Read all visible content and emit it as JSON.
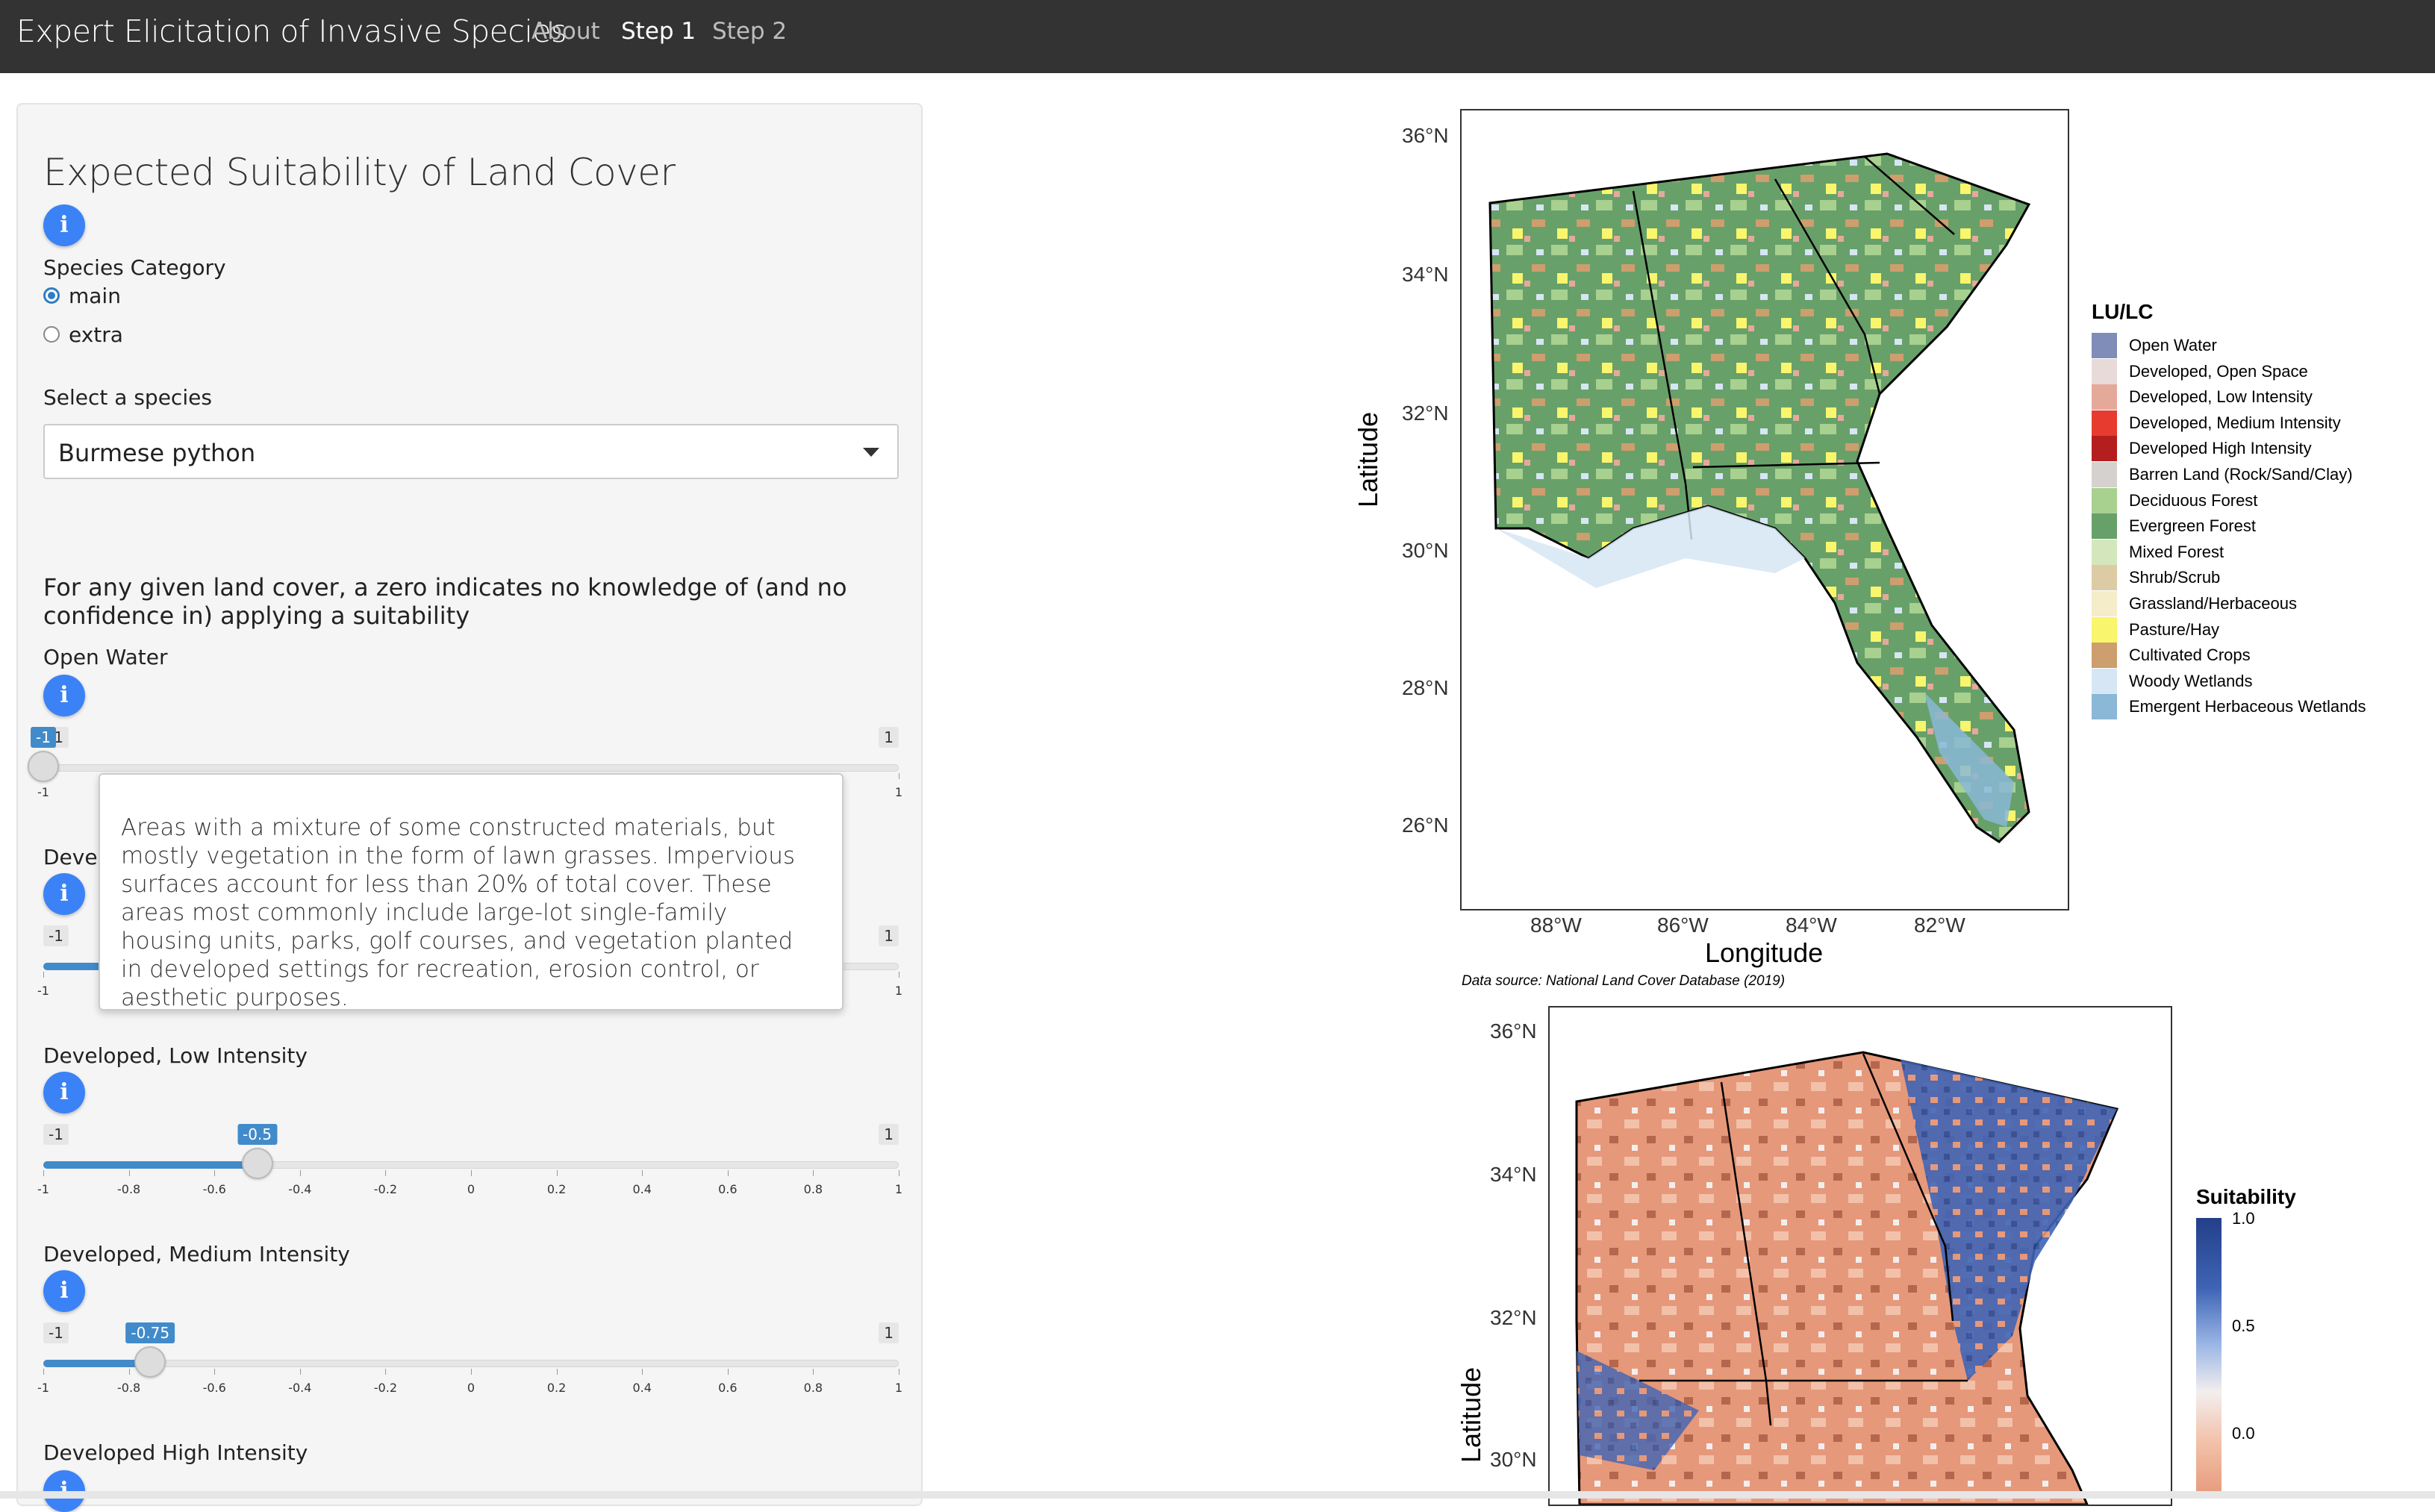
{
  "navbar": {
    "brand": "Expert Elicitation of Invasive Species",
    "links": [
      "About",
      "Step 1",
      "Step 2"
    ],
    "active": "Step 1"
  },
  "sidebar": {
    "title": "Expected Suitability of Land Cover",
    "species_category_label": "Species Category",
    "radio_options": [
      "main",
      "extra"
    ],
    "radio_selected": "main",
    "select_label": "Select a species",
    "select_value": "Burmese python",
    "description": "For any given land cover, a zero indicates no knowledge of (and no confidence in) applying a suitability",
    "slider_ticks": [
      "-1",
      "-0.8",
      "-0.6",
      "-0.4",
      "-0.2",
      "0",
      "0.2",
      "0.4",
      "0.6",
      "0.8",
      "1"
    ],
    "slider_min": "-1",
    "slider_max": "1",
    "sliders": [
      {
        "label": "Open Water",
        "value": "-1",
        "num": -1
      },
      {
        "label": "Developed, Open Space",
        "label_visible": "Develo",
        "value": "-1",
        "num": -0.4
      },
      {
        "label": "Developed, Low Intensity",
        "value": "-0.5",
        "num": -0.5
      },
      {
        "label": "Developed, Medium Intensity",
        "value": "-0.75",
        "num": -0.75
      },
      {
        "label": "Developed High Intensity"
      }
    ],
    "tooltip": "Areas with a mixture of some constructed materials, but mostly vegetation in the form of lawn grasses. Impervious surfaces account for less than 20% of total cover. These areas most commonly include large-lot single-family housing units, parks, golf courses, and vegetation planted in developed settings for recreation, erosion control, or aesthetic purposes."
  },
  "map1": {
    "lat_ticks": [
      "36°N",
      "34°N",
      "32°N",
      "30°N",
      "28°N",
      "26°N"
    ],
    "lon_ticks": [
      "88°W",
      "86°W",
      "84°W",
      "82°W"
    ],
    "xlabel": "Longitude",
    "ylabel": "Latitude",
    "legend_title": "LU/LC",
    "legend": [
      {
        "label": "Open Water",
        "color": "#7f8db8"
      },
      {
        "label": "Developed, Open Space",
        "color": "#e9dada"
      },
      {
        "label": "Developed, Low Intensity",
        "color": "#e5a99a"
      },
      {
        "label": "Developed, Medium Intensity",
        "color": "#e63b2e"
      },
      {
        "label": "Developed High Intensity",
        "color": "#b51e1e"
      },
      {
        "label": "Barren Land (Rock/Sand/Clay)",
        "color": "#d5d1ce"
      },
      {
        "label": "Deciduous Forest",
        "color": "#a8d08f"
      },
      {
        "label": "Evergreen Forest",
        "color": "#68a06a"
      },
      {
        "label": "Mixed Forest",
        "color": "#d4e7bc"
      },
      {
        "label": "Shrub/Scrub",
        "color": "#ddcba6"
      },
      {
        "label": "Grassland/Herbaceous",
        "color": "#f5ecc9"
      },
      {
        "label": "Pasture/Hay",
        "color": "#f9f56c"
      },
      {
        "label": "Cultivated Crops",
        "color": "#cd9e6e"
      },
      {
        "label": "Woody Wetlands",
        "color": "#d6e6f4"
      },
      {
        "label": "Emergent Herbaceous Wetlands",
        "color": "#8ab8d6"
      }
    ],
    "caption": "Data source: National Land Cover Database (2019)"
  },
  "map2": {
    "lat_ticks": [
      "36°N",
      "34°N",
      "32°N",
      "30°N"
    ],
    "ylabel": "Latitude",
    "legend_title": "Suitability",
    "colorbar_labels": [
      "1.0",
      "0.5",
      "0.0"
    ]
  }
}
